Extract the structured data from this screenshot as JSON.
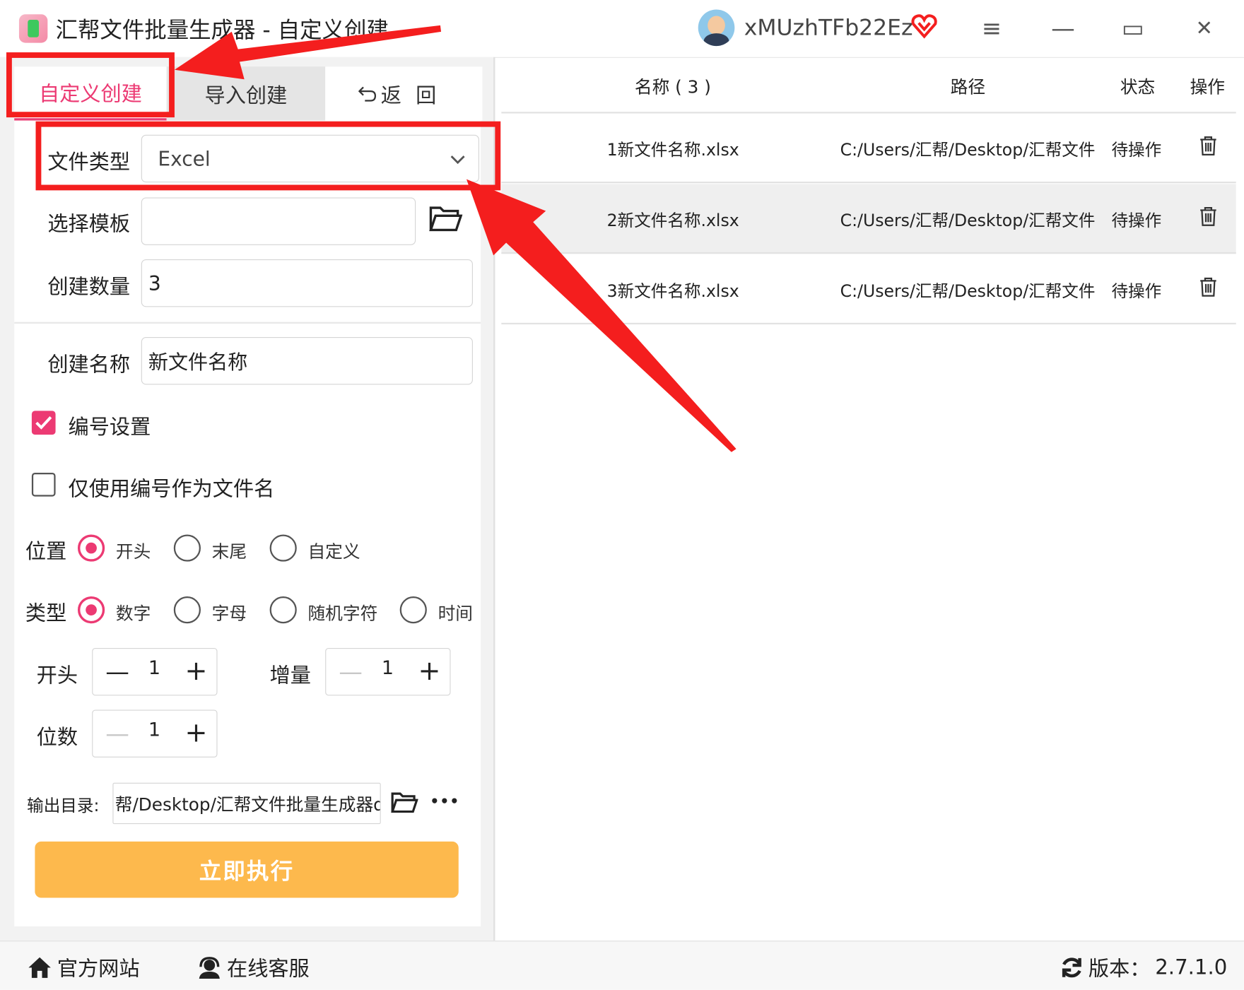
{
  "window": {
    "title": "汇帮文件批量生成器 - 自定义创建",
    "username": "xMUzhTFb22Ez",
    "menu_icon": "≡",
    "minimize_icon": "—",
    "maximize_icon": "▭",
    "close_icon": "✕"
  },
  "tabs": [
    {
      "label": "自定义创建",
      "active": true
    },
    {
      "label": "导入创建",
      "active": false
    },
    {
      "label": "返回",
      "icon": "back-arrow-icon"
    }
  ],
  "form": {
    "file_type_label": "文件类型",
    "file_type_value": "Excel",
    "template_label": "选择模板",
    "template_value": "",
    "count_label": "创建数量",
    "count_value": "3",
    "name_label": "创建名称",
    "name_value": "新文件名称",
    "numbering_label": "编号设置",
    "numbering_checked": true,
    "number_only_label": "仅使用编号作为文件名",
    "number_only_checked": false,
    "position_label": "位置",
    "position_options": [
      "开头",
      "末尾",
      "自定义"
    ],
    "position_selected": "开头",
    "type_label": "类型",
    "type_options": [
      "数字",
      "字母",
      "随机字符",
      "时间"
    ],
    "type_selected": "数字",
    "start_label": "开头",
    "start_value": "1",
    "increment_label": "增量",
    "increment_value": "1",
    "digits_label": "位数",
    "digits_value": "1",
    "output_label": "输出目录:",
    "output_value": "帮/Desktop/汇帮文件批量生成器q",
    "more_icon": "•••",
    "execute_label": "立即执行"
  },
  "table": {
    "headers": {
      "name": "名称 ( 3 )",
      "path": "路径",
      "status": "状态",
      "action": "操作"
    },
    "rows": [
      {
        "name": "1新文件名称.xlsx",
        "path": "C:/Users/汇帮/Desktop/汇帮文件",
        "status": "待操作"
      },
      {
        "name": "2新文件名称.xlsx",
        "path": "C:/Users/汇帮/Desktop/汇帮文件",
        "status": "待操作"
      },
      {
        "name": "3新文件名称.xlsx",
        "path": "C:/Users/汇帮/Desktop/汇帮文件",
        "status": "待操作"
      }
    ]
  },
  "footer": {
    "website_label": "官方网站",
    "support_label": "在线客服",
    "version_label": "版本：",
    "version_value": "2.7.1.0"
  },
  "colors": {
    "accent": "#ec3a73",
    "execute_button": "#fdb94d",
    "annotation_red": "#f41e1e"
  }
}
